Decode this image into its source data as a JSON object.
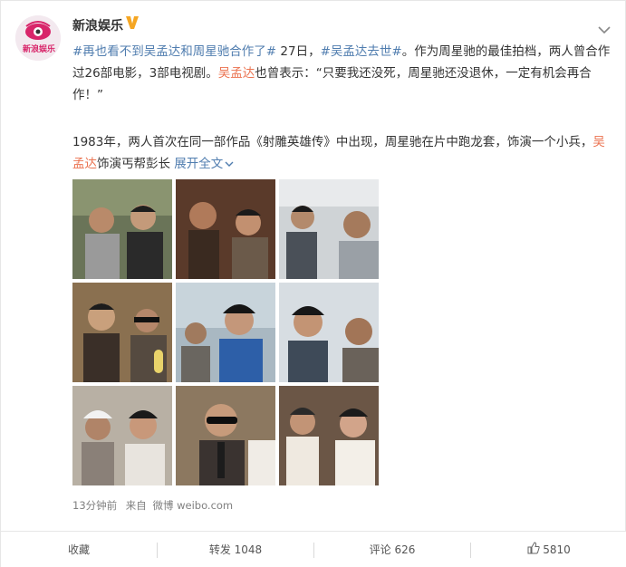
{
  "account": {
    "name": "新浪娱乐",
    "avatar_text": "新浪娱乐",
    "verified_icon": "verified-v-icon",
    "menu_icon": "chevron-down-icon"
  },
  "post": {
    "p1": {
      "tag1": "#再也看不到吴孟达和周星驰合作了#",
      "t1": " 27日，",
      "tag2": "#吴孟达去世#",
      "t2": "。作为周星驰的最佳拍档，两人曾合作过26部电影，3部电视剧。",
      "link1": "吴孟达",
      "t3": "也曾表示：“只要我还没死，周星驰还没退休，一定有机会再合作！”"
    },
    "p2": {
      "t1": "1983年，两人首次在同一部作品《射雕英雄传》中出现，周星驰在片中跑龙套，饰演一个小兵，",
      "link1": "吴孟达",
      "t2": "饰演丐帮彭长",
      "expand": "展开全文"
    }
  },
  "photos": [
    "photo-1",
    "photo-2",
    "photo-3",
    "photo-4",
    "photo-5",
    "photo-6",
    "photo-7",
    "photo-8",
    "photo-9"
  ],
  "meta": {
    "time": "13分钟前",
    "source_prefix": "来自",
    "source": "微博 weibo.com"
  },
  "actions": {
    "favorite": "收藏",
    "repost": "转发 1048",
    "comment": "评论 626",
    "like": "5810",
    "like_icon": "thumbs-up-icon"
  },
  "colors": {
    "tag": "#eb7350",
    "link": "#507daf",
    "meta": "#808080"
  }
}
